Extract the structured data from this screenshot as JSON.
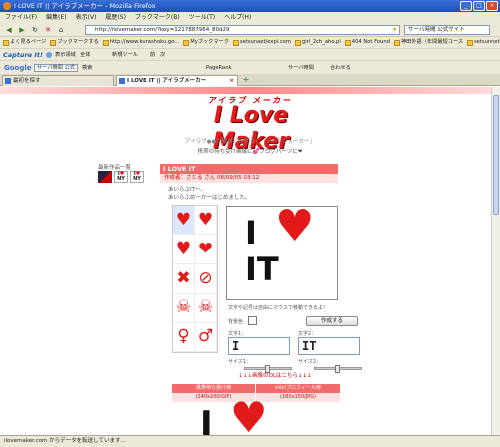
{
  "window": {
    "title": "I LOVE IT || アイラブメーカー - Mozilla Firefox"
  },
  "menu": [
    "ファイル(F)",
    "編集(E)",
    "表示(V)",
    "履歴(S)",
    "ブックマーク(B)",
    "ツール(T)",
    "ヘルプ(H)"
  ],
  "nav": {
    "url": "http://ilovemaker.com/?key=1217887964_80d29",
    "search_placeholder": "サーバ時間 公式サイト"
  },
  "bookmarks": [
    "よく見るページ",
    "ブックマークする",
    "http://www.kurashoku.go...",
    "Myブックマーク",
    "setsunaet/expi.com",
    "girl_2ch_aho.pl",
    "404 Not Found",
    "神田外語（年間最短コース",
    "setsunnet.info"
  ],
  "capture": {
    "brand": "Capture It!",
    "items": [
      "表示領域",
      "全体",
      "新規ツール",
      "前",
      "次"
    ]
  },
  "gbar": {
    "logo": "Google",
    "input": "サーバ時間 公式",
    "items": [
      "検索",
      "PageRank",
      "サーバ時間",
      "合わせる"
    ]
  },
  "tabs": [
    {
      "label": "最初を探す"
    },
    {
      "label": "I LOVE IT || アイラブメーカー"
    }
  ],
  "page": {
    "logo_small": "アイラブ メーカー",
    "logo_big": "I Love Maker",
    "tagline": "アイラブ●●が簡単に作れる！「アイラブメーカー」",
    "tagline2": "携帯の待ち受け画像に💕ブログパーツに❤",
    "recent_label": "最新作品一覧",
    "thumb_texts": [
      {
        "line1": "I",
        "line2": "NY"
      },
      {
        "line1": "I",
        "line2": "NY"
      }
    ],
    "header": "I LOVE IT",
    "author": "作成者：さとる さん  08/09/05 03:12",
    "desc1": "あいらぶIT～。",
    "desc2": "あいらぶめーかーはじめました。",
    "palette": [
      "♥",
      "♥",
      "♥",
      "❤",
      "✖",
      "⊘",
      "☠",
      "☠",
      "♀",
      "♂"
    ],
    "canvas": {
      "line1": "I",
      "line2": "IT",
      "symbol": "♥"
    },
    "hint": "文字や記号は自由にマウスで移動できるよ！",
    "bg_label": "背景色",
    "make_button": "作成する",
    "text1_label": "文字1：",
    "text1_value": "I",
    "text2_label": "文字2：",
    "text2_value": "IT",
    "size1_label": "サイズ1：",
    "size2_label": "サイズ2：",
    "arrows": "↓↓↓画像のDLはこちら↓↓↓",
    "dl_tab1": "携帯待ち受け用",
    "dl_tab2": "mixiプロフィール用",
    "dl_sub1": "(240x200/GIF)",
    "dl_sub2": "(180x150/JPG)",
    "preview": {
      "text": "I",
      "symbol": "♥"
    }
  },
  "status": "ilovemaker.com からデータを転送しています..."
}
